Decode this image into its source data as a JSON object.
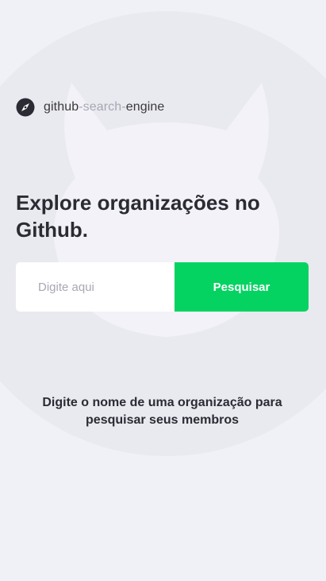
{
  "brand": {
    "icon": "compass-icon",
    "name_part1": "github",
    "separator1": "-",
    "name_part2": "search",
    "separator2": "-",
    "name_part3": "engine"
  },
  "hero": {
    "title": "Explore organizações no Github."
  },
  "search": {
    "placeholder": "Digite aqui",
    "value": "",
    "button_label": "Pesquisar"
  },
  "empty_state": {
    "message": "Digite o nome de uma organização para pesquisar seus membros"
  },
  "colors": {
    "background": "#f0f0f7",
    "accent": "#04d361",
    "text_dark": "#2b2b33",
    "text_muted": "#a8a8b3"
  },
  "background_icon": "github-octocat-icon"
}
